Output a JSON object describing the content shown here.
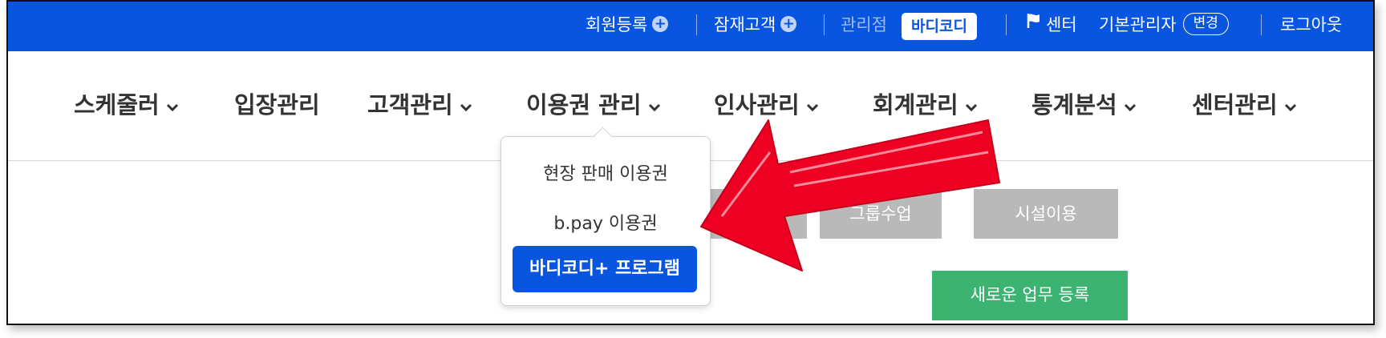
{
  "topbar": {
    "member_register": "회원등록",
    "potential_customer": "잠재고객",
    "branch_label": "관리점",
    "branch_name": "바디코디",
    "center": "센터",
    "user_name": "기본관리자",
    "change_label": "변경",
    "logout": "로그아웃"
  },
  "nav": {
    "items": [
      {
        "label": "스케줄러",
        "has_dropdown": true
      },
      {
        "label": "입장관리",
        "has_dropdown": false
      },
      {
        "label": "고객관리",
        "has_dropdown": true
      },
      {
        "label": "이용권 관리",
        "has_dropdown": true
      },
      {
        "label": "인사관리",
        "has_dropdown": true
      },
      {
        "label": "회계관리",
        "has_dropdown": true
      },
      {
        "label": "통계분석",
        "has_dropdown": true
      },
      {
        "label": "센터관리",
        "has_dropdown": true
      }
    ]
  },
  "dropdown": {
    "items": [
      {
        "label": "현장 판매 이용권",
        "active": false
      },
      {
        "label": "b.pay 이용권",
        "active": false
      },
      {
        "label": "바디코디+ 프로그램",
        "active": true
      }
    ]
  },
  "content": {
    "buttons": [
      "",
      "그룹수업",
      "시설이용"
    ],
    "new_task": "새로운 업무 등록"
  },
  "colors": {
    "primary": "#0a55e0",
    "green": "#3cb371",
    "gray_button": "#b9b9b9",
    "annotation_arrow": "#ee0022"
  }
}
